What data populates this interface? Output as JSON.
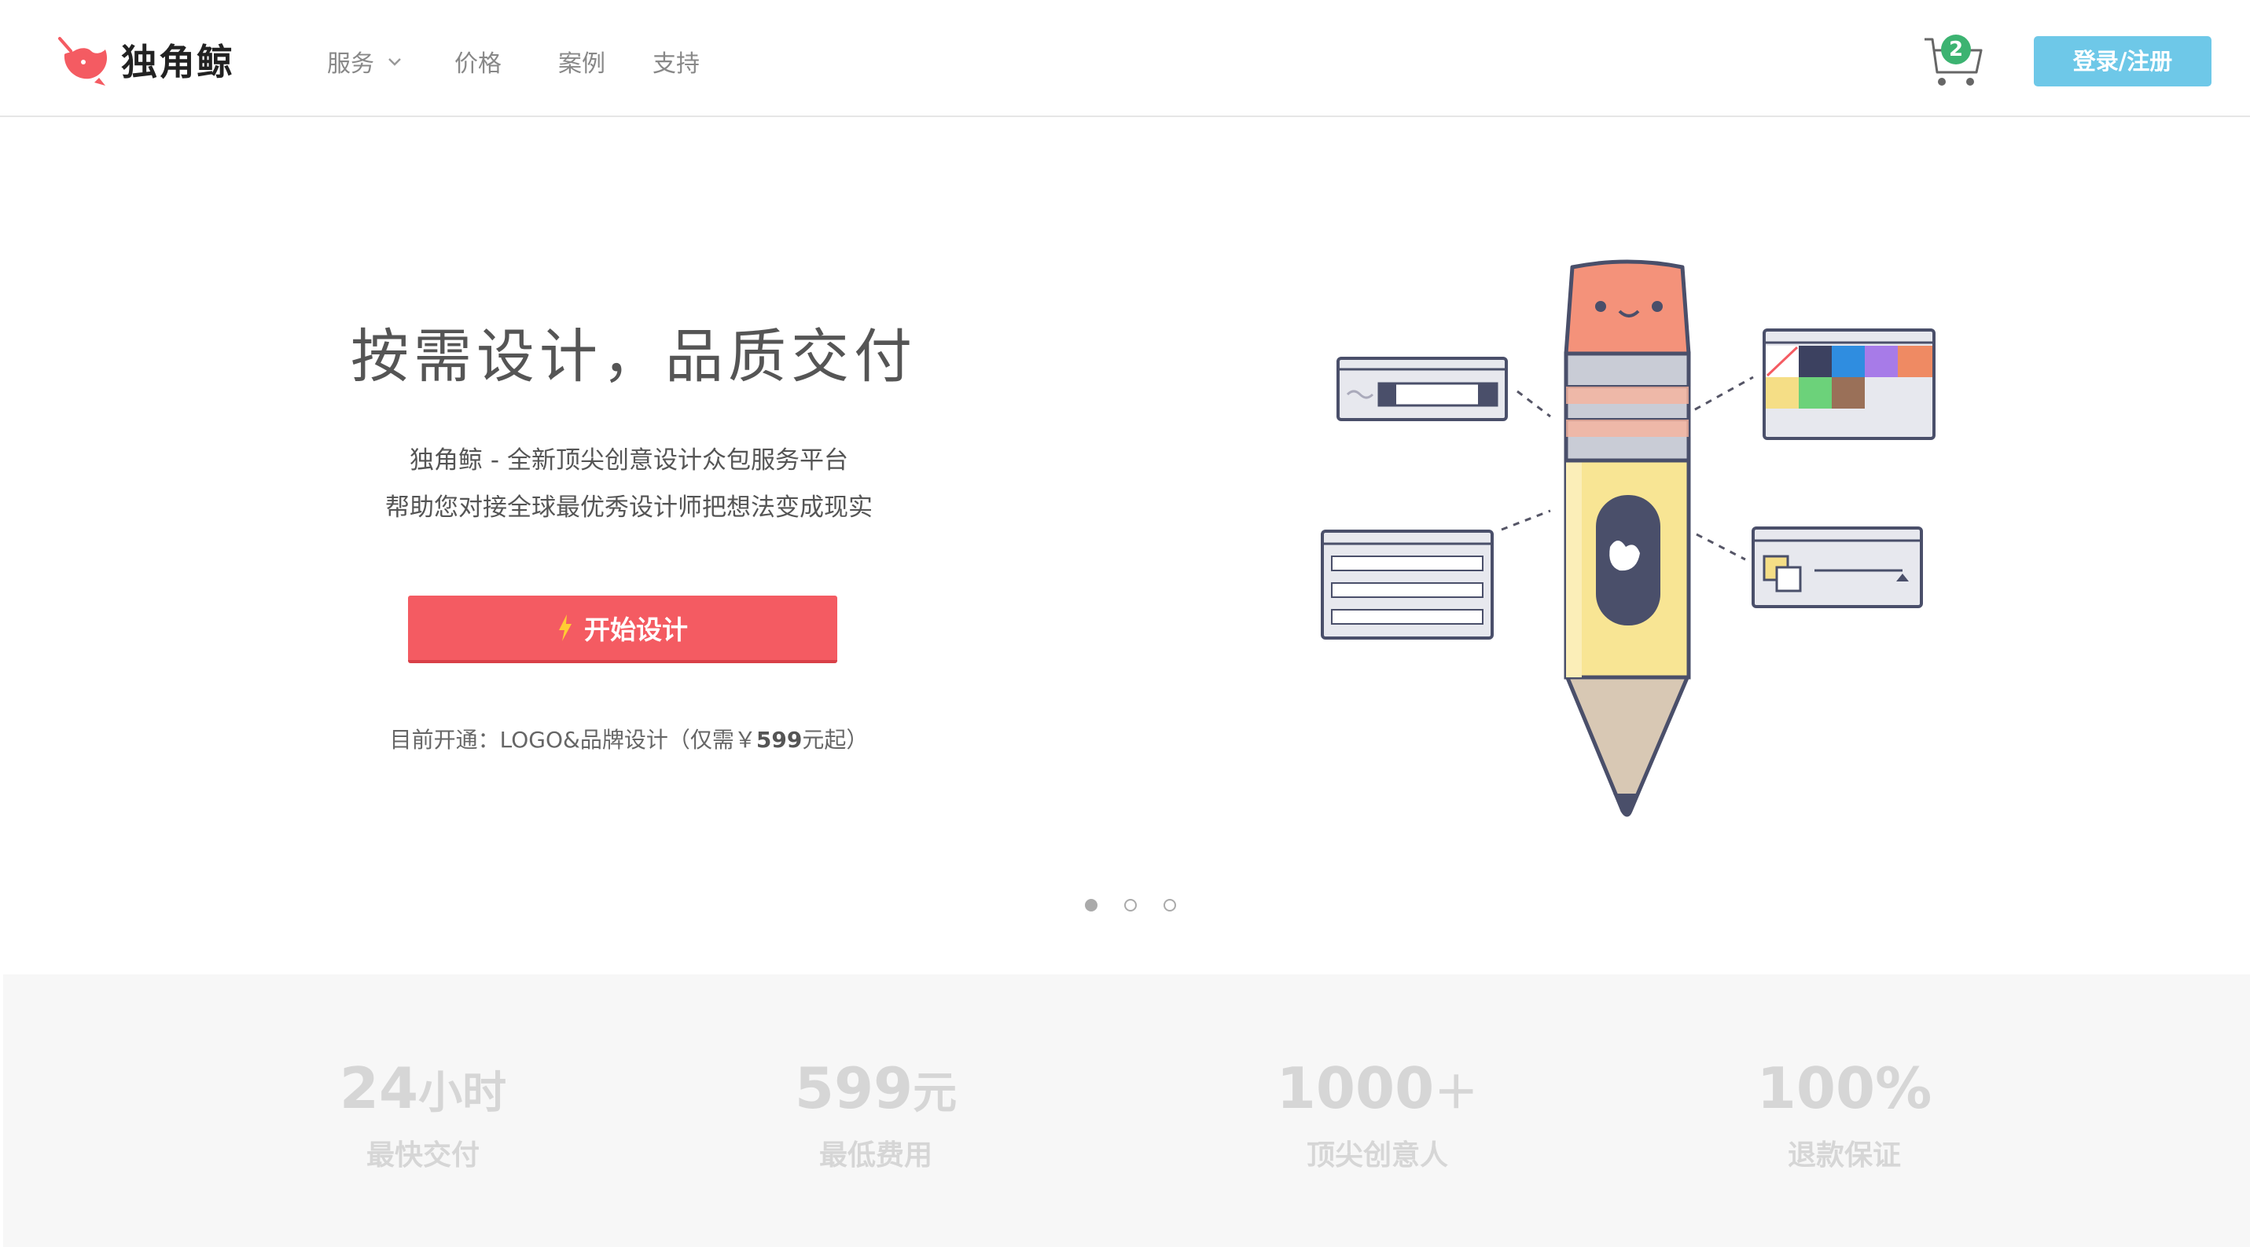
{
  "header": {
    "logo_text": "独角鲸",
    "nav": [
      {
        "label": "服务",
        "has_dropdown": true
      },
      {
        "label": "价格"
      },
      {
        "label": "案例"
      },
      {
        "label": "支持"
      }
    ],
    "cart_count": "2",
    "login_label": "登录/注册"
  },
  "hero": {
    "title": "按需设计，品质交付",
    "subtitle_line1": "独角鲸 - 全新顶尖创意设计众包服务平台",
    "subtitle_line2": "帮助您对接全球最优秀设计师把想法变成现实",
    "cta_label": "开始设计",
    "note_prefix": "目前开通：LOGO&品牌设计（仅需￥",
    "note_price": "599",
    "note_suffix": "元起）"
  },
  "carousel": {
    "count": 3,
    "active": 0
  },
  "stats": [
    {
      "value": "24",
      "unit": "小时",
      "label": "最快交付"
    },
    {
      "value": "599",
      "unit": "元",
      "label": "最低费用"
    },
    {
      "value": "1000",
      "unit": "＋",
      "label": "顶尖创意人"
    },
    {
      "value": "100%",
      "unit": "",
      "label": "退款保证"
    }
  ],
  "colors": {
    "brand_red": "#f45b62",
    "login_blue": "#6ec8e8",
    "badge_green": "#3cb371"
  }
}
